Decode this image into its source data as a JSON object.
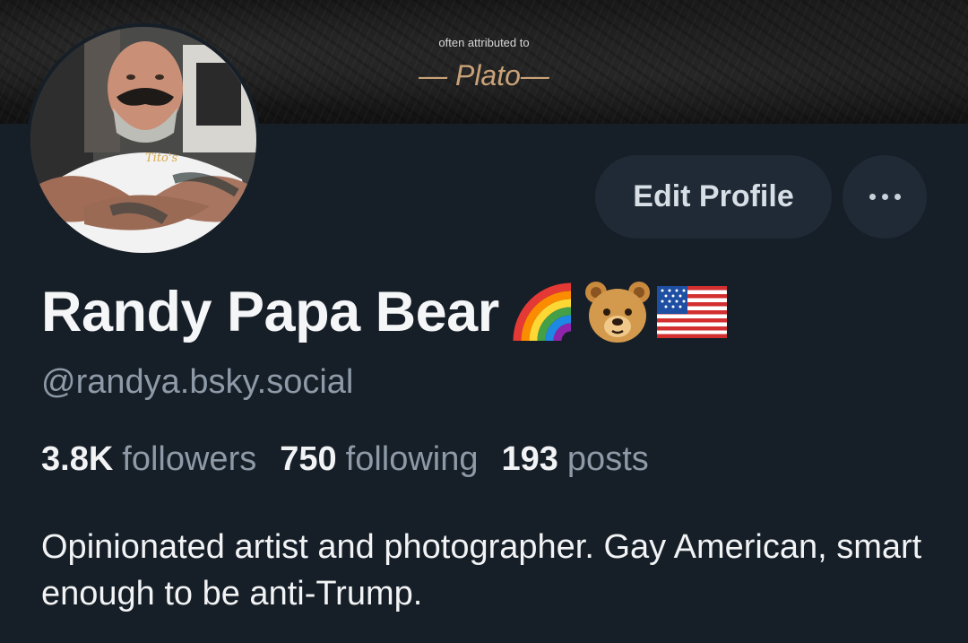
{
  "banner": {
    "quote_attribution": "often attributed to",
    "quote_author": "— Plato—"
  },
  "profile": {
    "display_name": "Randy Papa Bear",
    "name_emojis": [
      "rainbow-emoji",
      "bear-face-emoji",
      "us-flag-emoji"
    ],
    "handle": "@randya.bsky.social",
    "bio": "Opinionated artist and photographer. Gay American, smart enough to be anti-Trump."
  },
  "stats": {
    "followers_count": "3.8K",
    "followers_label": "followers",
    "following_count": "750",
    "following_label": "following",
    "posts_count": "193",
    "posts_label": "posts"
  },
  "actions": {
    "edit_profile_label": "Edit Profile",
    "more_icon": "ellipsis-icon"
  },
  "colors": {
    "background": "#161e27",
    "button_bg": "#1f2a36",
    "secondary_text": "#8e9aa8",
    "quote_author": "#c9a277"
  }
}
